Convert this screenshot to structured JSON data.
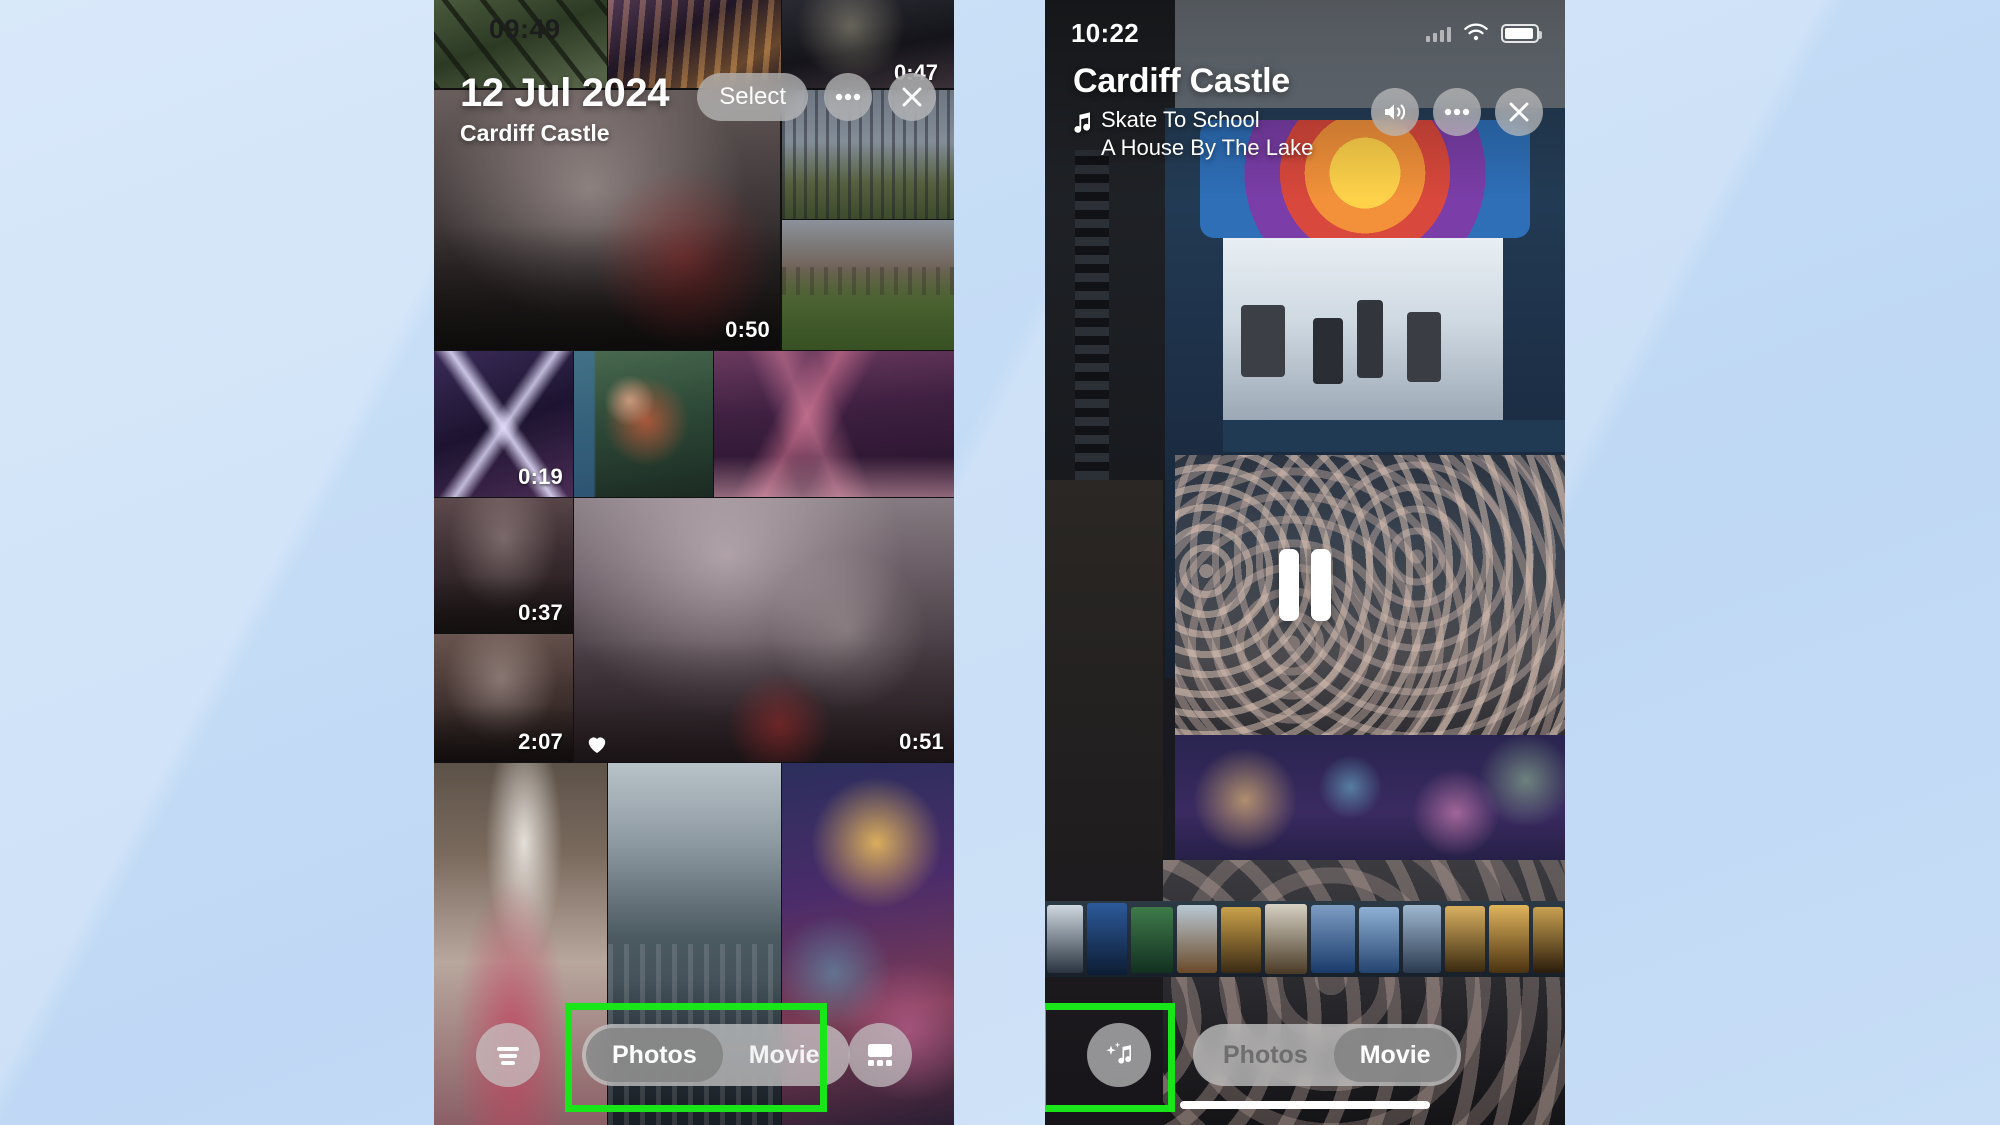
{
  "background": {
    "color": "#c2dbf5"
  },
  "highlight": {
    "color": "#19e619"
  },
  "left_phone": {
    "name": "photos-memory-grid",
    "status_bar": {
      "time": "09:49"
    },
    "top_right_duration": "0:47",
    "header": {
      "date": "12 Jul 2024",
      "location": "Cardiff Castle"
    },
    "top_actions": {
      "select_label": "Select",
      "more_icon": "ellipsis-icon",
      "close_icon": "close-icon"
    },
    "grid": {
      "items": [
        {
          "id": "tile-1",
          "duration": "0:50",
          "favourite": false
        },
        {
          "id": "tile-2",
          "duration": "",
          "favourite": false
        },
        {
          "id": "tile-3",
          "duration": "",
          "favourite": false
        },
        {
          "id": "tile-4",
          "duration": "0:19",
          "favourite": false
        },
        {
          "id": "tile-5",
          "duration": "",
          "favourite": false
        },
        {
          "id": "tile-6",
          "duration": "",
          "favourite": false
        },
        {
          "id": "tile-7",
          "duration": "0:37",
          "favourite": false
        },
        {
          "id": "tile-8",
          "duration": "2:07",
          "favourite": false
        },
        {
          "id": "tile-9",
          "duration": "0:51",
          "favourite": true
        }
      ]
    },
    "bottom_bar": {
      "filter_icon": "filter-icon",
      "layout_icon": "grid-layout-icon",
      "segmented": {
        "options": [
          "Photos",
          "Movie"
        ],
        "selected": "Photos"
      }
    }
  },
  "right_phone": {
    "name": "memory-movie-player",
    "status_bar": {
      "time": "10:22",
      "wifi_icon": "wifi-icon",
      "battery_icon": "battery-icon"
    },
    "header": {
      "title": "Cardiff Castle",
      "music_icon": "music-note-icon",
      "song_title": "Skate To School",
      "song_artist": "A House By The Lake"
    },
    "top_actions": {
      "volume_icon": "speaker-icon",
      "more_icon": "ellipsis-icon",
      "close_icon": "close-icon"
    },
    "playback": {
      "state_icon": "pause-icon"
    },
    "bottom_bar": {
      "music_icon": "music-sparkle-icon",
      "segmented": {
        "options": [
          "Photos",
          "Movie"
        ],
        "selected": "Movie"
      }
    },
    "home_indicator": "home-indicator"
  }
}
